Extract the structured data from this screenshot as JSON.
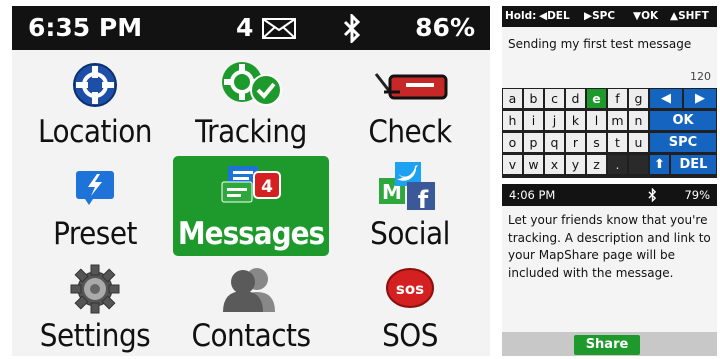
{
  "main": {
    "status": {
      "time": "6:35 PM",
      "message_count": "4",
      "battery": "86%"
    },
    "tiles": [
      {
        "label": "Location",
        "icon": "location-icon"
      },
      {
        "label": "Tracking",
        "icon": "tracking-icon"
      },
      {
        "label": "Check",
        "icon": "check-mailbox-icon"
      },
      {
        "label": "Preset",
        "icon": "preset-lightning-icon"
      },
      {
        "label": "Messages",
        "icon": "messages-icon",
        "badge": "4",
        "selected": true
      },
      {
        "label": "Social",
        "icon": "social-icon"
      },
      {
        "label": "Settings",
        "icon": "gear-icon"
      },
      {
        "label": "Contacts",
        "icon": "contacts-icon"
      },
      {
        "label": "SOS",
        "icon": "sos-icon",
        "badge": "sos"
      }
    ]
  },
  "keyboard": {
    "hints": {
      "hold": "Hold:",
      "del": "DEL",
      "spc": "SPC",
      "ok": "OK",
      "shft": "SHFT"
    },
    "text": "Sending my first test message",
    "counter": "120",
    "rows": [
      [
        "a",
        "b",
        "c",
        "d",
        "e",
        "f",
        "g"
      ],
      [
        "h",
        "i",
        "j",
        "k",
        "l",
        "m",
        "n"
      ],
      [
        "o",
        "p",
        "q",
        "r",
        "s",
        "t",
        "u"
      ],
      [
        "v",
        "w",
        "x",
        "y",
        "z",
        ".",
        ""
      ]
    ],
    "highlighted_key": "e",
    "function_keys": {
      "ok": "OK",
      "spc": "SPC",
      "del": "DEL"
    }
  },
  "share": {
    "status": {
      "time": "4:06 PM",
      "battery": "79%"
    },
    "message": "Let your friends know that you're tracking. A description and link to your MapShare page will be included with the message.",
    "button": "Share"
  },
  "colors": {
    "accent_green": "#1e9a2c",
    "key_blue": "#1565c0",
    "sos_red": "#d42020"
  }
}
